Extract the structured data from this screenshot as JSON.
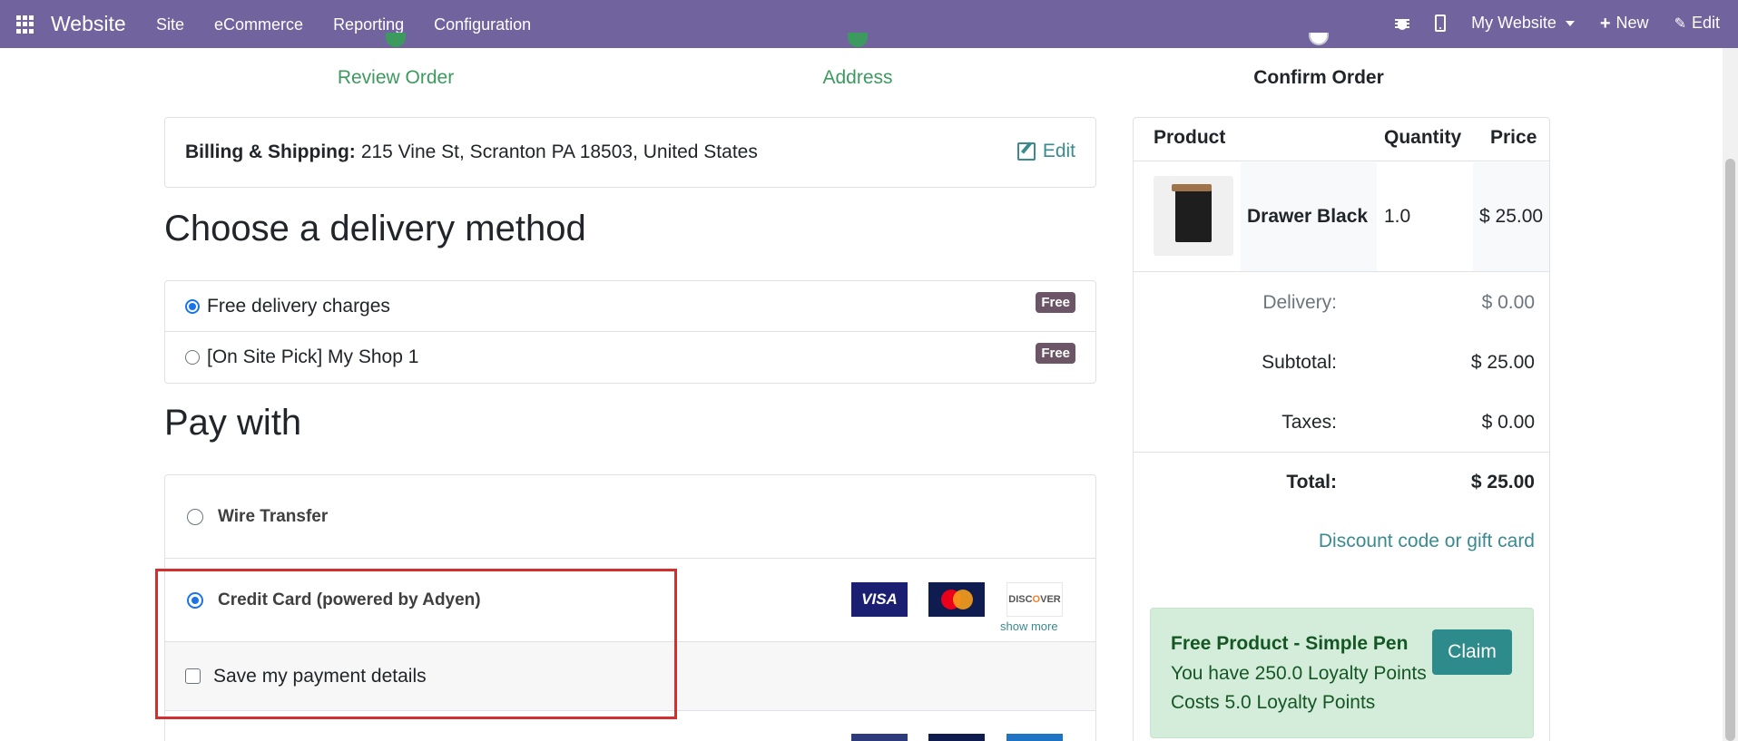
{
  "topbar": {
    "brand": "Website",
    "menu": [
      "Site",
      "eCommerce",
      "Reporting",
      "Configuration"
    ],
    "website_selector": "My Website",
    "new_label": "New",
    "edit_label": "Edit"
  },
  "steps": [
    {
      "label": "Review Order",
      "state": "done"
    },
    {
      "label": "Address",
      "state": "done"
    },
    {
      "label": "Confirm Order",
      "state": "current"
    }
  ],
  "billing": {
    "label": "Billing & Shipping:",
    "address": "215 Vine St, Scranton PA 18503, United States",
    "edit_label": "Edit"
  },
  "delivery": {
    "heading": "Choose a delivery method",
    "options": [
      {
        "label": "Free delivery charges",
        "badge": "Free",
        "selected": true
      },
      {
        "label": "[On Site Pick] My Shop 1",
        "badge": "Free",
        "selected": false
      }
    ]
  },
  "payment": {
    "heading": "Pay with",
    "methods": [
      {
        "label": "Wire Transfer",
        "selected": false
      },
      {
        "label": "Credit Card (powered by Adyen)",
        "selected": true
      }
    ],
    "cards": [
      "VISA",
      "MasterCard",
      "DISCOVER"
    ],
    "show_more": "show more",
    "save_details": "Save my payment details"
  },
  "summary": {
    "headers": {
      "product": "Product",
      "quantity": "Quantity",
      "price": "Price"
    },
    "item": {
      "name": "Drawer Black",
      "quantity": "1.0",
      "price": "$ 25.00"
    },
    "delivery_label": "Delivery:",
    "delivery_value": "$ 0.00",
    "subtotal_label": "Subtotal:",
    "subtotal_value": "$ 25.00",
    "taxes_label": "Taxes:",
    "taxes_value": "$ 0.00",
    "total_label": "Total:",
    "total_value": "$ 25.00",
    "discount_link": "Discount code or gift card"
  },
  "promo": {
    "title": "Free Product - Simple Pen",
    "line1": "You have 250.0 Loyalty Points",
    "line2": "Costs 5.0 Loyalty Points",
    "button": "Claim"
  },
  "colors": {
    "navbar": "#71639e",
    "step_done": "#3c9a5f",
    "link": "#3a8a8f",
    "badge": "#6b5566",
    "highlight": "#d32f2f",
    "promo_bg": "#d4edda"
  }
}
